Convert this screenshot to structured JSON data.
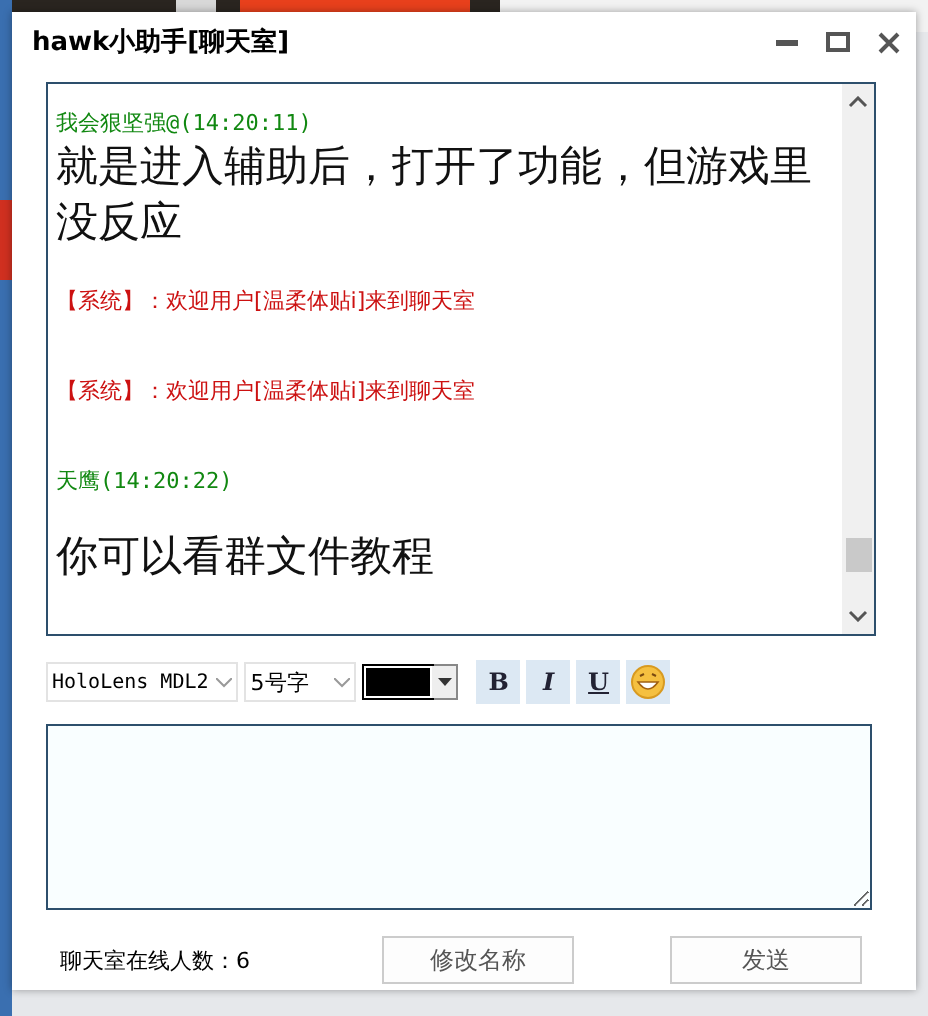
{
  "window": {
    "title": "hawk小助手[聊天室]"
  },
  "messages": [
    {
      "kind": "user",
      "sender": "我会狠坚强@(14:20:11)",
      "text": "就是进入辅助后，打开了功能，但游戏里没反应"
    },
    {
      "kind": "system",
      "text": "【系统】：欢迎用户[温柔体贴i]来到聊天室"
    },
    {
      "kind": "system",
      "text": "【系统】：欢迎用户[温柔体贴i]来到聊天室"
    },
    {
      "kind": "user",
      "sender": "天鹰(14:20:22)",
      "text": "你可以看群文件教程"
    }
  ],
  "toolbar": {
    "font": "HoloLens MDL2",
    "size": "5号字",
    "color": "#000000",
    "bold": "B",
    "italic": "I",
    "underline": "U"
  },
  "footer": {
    "online": "聊天室在线人数：6",
    "rename_button": "修改名称",
    "send_button": "发送"
  }
}
